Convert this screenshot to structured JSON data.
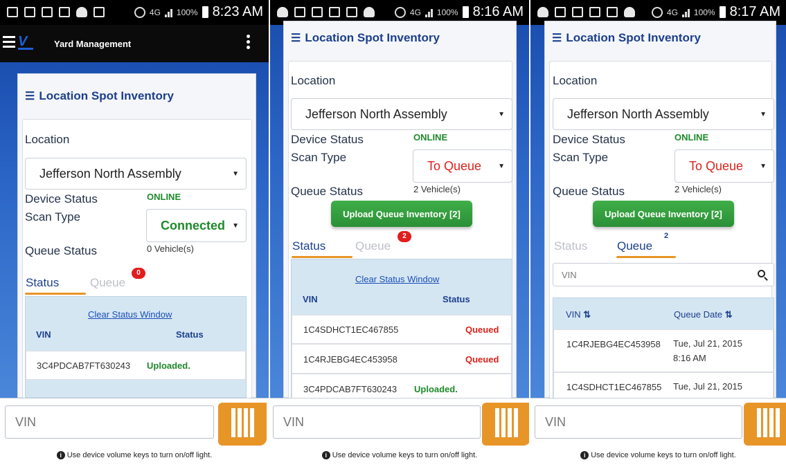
{
  "screens": [
    {
      "statusbar": {
        "network": "4G",
        "signal": "LTE",
        "battery": "100%",
        "time": "8:23 AM"
      },
      "appbar": {
        "title": "Yard Management"
      },
      "card_title": "Location Spot Inventory",
      "location": {
        "label": "Location",
        "value": "Jefferson North Assembly"
      },
      "device_status": {
        "label": "Device Status",
        "value": "ONLINE"
      },
      "scan_type": {
        "label": "Scan Type",
        "value": "Connected"
      },
      "queue_status": {
        "label": "Queue Status",
        "value": "0 Vehicle(s)"
      },
      "tabs": {
        "status": "Status",
        "queue": "Queue",
        "badge": "0"
      },
      "status_panel": {
        "clear_link": "Clear Status Window",
        "headers": {
          "vin": "VIN",
          "status": "Status"
        },
        "rows": [
          {
            "vin": "3C4PDCAB7FT630243",
            "status": "Uploaded."
          }
        ]
      },
      "vin_input": {
        "placeholder": "VIN"
      },
      "hint": "Use device volume keys to turn on/off light."
    },
    {
      "statusbar": {
        "network": "4G",
        "signal": "LTE",
        "battery": "100%",
        "time": "8:16 AM"
      },
      "card_title": "Location Spot Inventory",
      "location": {
        "label": "Location",
        "value": "Jefferson North Assembly"
      },
      "device_status": {
        "label": "Device Status",
        "value": "ONLINE"
      },
      "scan_type": {
        "label": "Scan Type",
        "value": "To Queue"
      },
      "queue_status": {
        "label": "Queue Status",
        "value": "2 Vehicle(s)"
      },
      "upload_button": "Upload Queue Inventory [2]",
      "tabs": {
        "status": "Status",
        "queue": "Queue",
        "badge": "2"
      },
      "status_panel": {
        "clear_link": "Clear Status Window",
        "headers": {
          "vin": "VIN",
          "status": "Status"
        },
        "rows": [
          {
            "vin": "1C4SDHCT1EC467855",
            "status": "Queued"
          },
          {
            "vin": "1C4RJEBG4EC453958",
            "status": "Queued"
          },
          {
            "vin": "3C4PDCAB7FT630243",
            "status": "Uploaded."
          }
        ]
      },
      "vin_input": {
        "placeholder": "VIN"
      },
      "hint": "Use device volume keys to turn on/off light."
    },
    {
      "statusbar": {
        "network": "4G",
        "signal": "LTE",
        "battery": "100%",
        "time": "8:17 AM"
      },
      "card_title": "Location Spot Inventory",
      "location": {
        "label": "Location",
        "value": "Jefferson North Assembly"
      },
      "device_status": {
        "label": "Device Status",
        "value": "ONLINE"
      },
      "scan_type": {
        "label": "Scan Type",
        "value": "To Queue"
      },
      "queue_status": {
        "label": "Queue Status",
        "value": "2 Vehicle(s)"
      },
      "upload_button": "Upload Queue Inventory [2]",
      "tabs": {
        "status": "Status",
        "queue": "Queue",
        "badge": "2"
      },
      "queue_panel": {
        "search_placeholder": "VIN",
        "headers": {
          "vin": "VIN",
          "date": "Queue Date",
          "sort_icon": "sort-arrows-icon"
        },
        "rows": [
          {
            "vin": "1C4RJEBG4EC453958",
            "date_line1": "Tue, Jul 21, 2015",
            "date_line2": "8:16 AM"
          },
          {
            "vin": "1C4SDHCT1EC467855",
            "date_line1": "Tue, Jul 21, 2015",
            "date_line2": ""
          }
        ]
      },
      "vin_input": {
        "placeholder": "VIN"
      },
      "hint": "Use device volume keys to turn on/off light."
    }
  ],
  "colors": {
    "accent_orange": "#e89527",
    "online_green": "#1e8a2a",
    "queued_red": "#d9231c",
    "link_blue": "#1a4fb6",
    "header_blue": "#1c3f8c"
  }
}
